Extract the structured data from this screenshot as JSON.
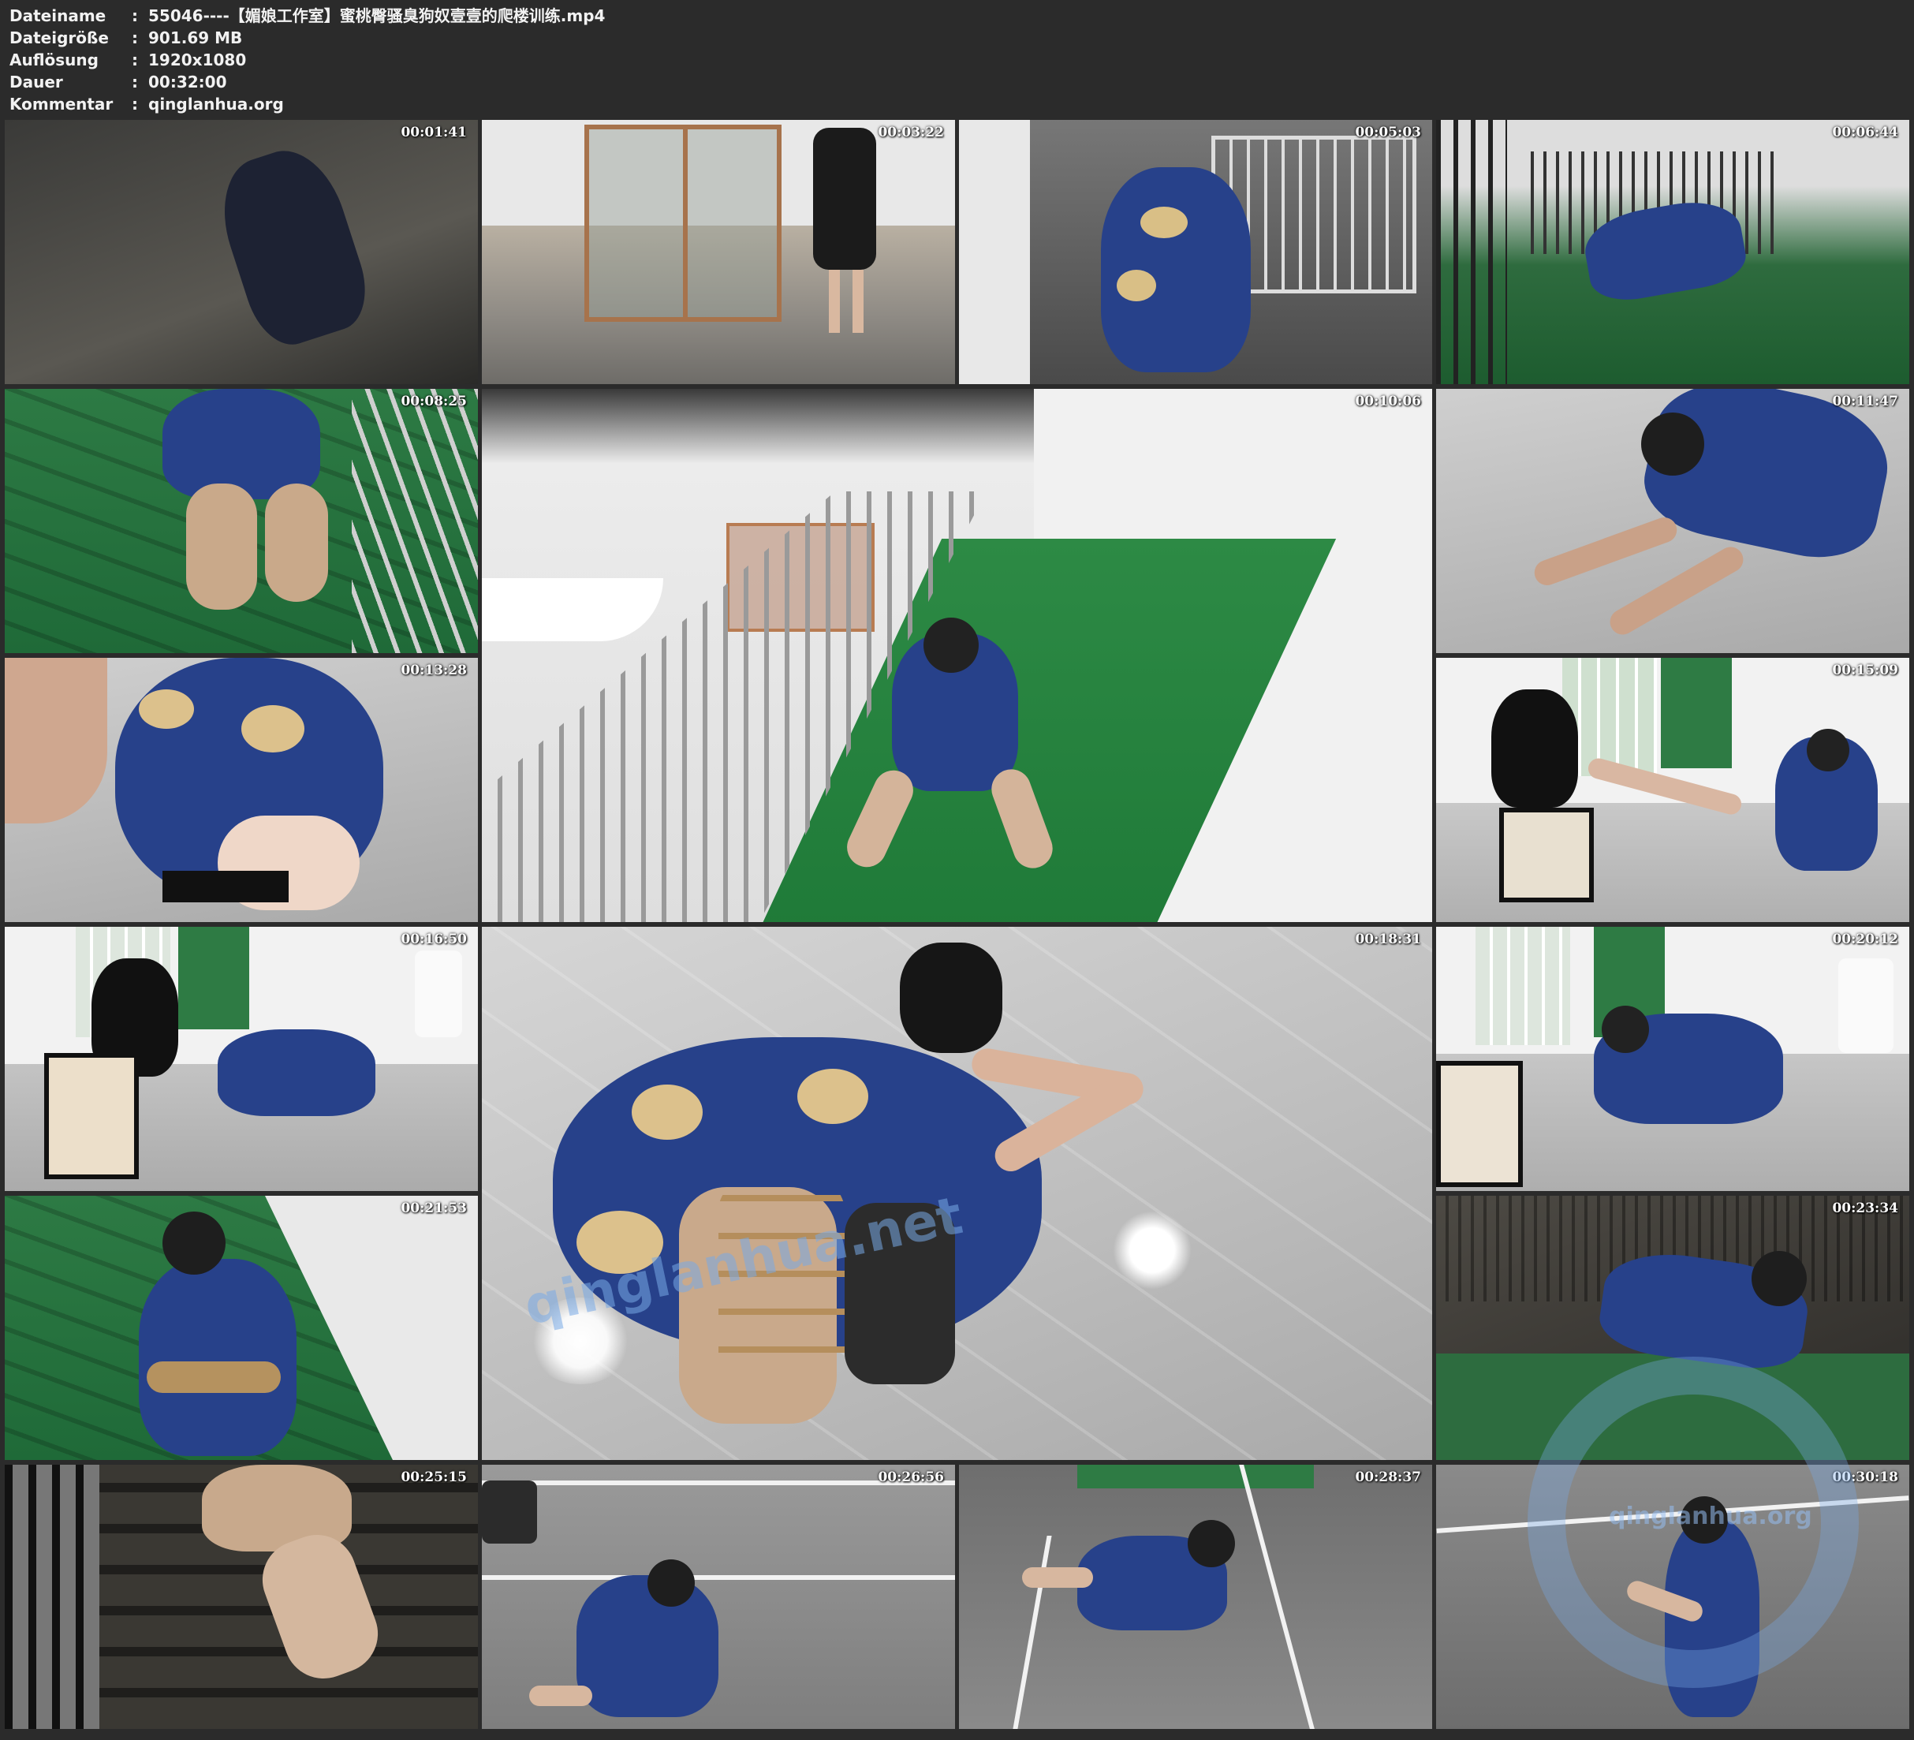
{
  "file_info": {
    "rows": [
      {
        "label": "Dateiname",
        "sep": ":",
        "value": "55046----【媚娘工作室】蜜桃臀骚臭狗奴壹壹的爬楼训练.mp4"
      },
      {
        "label": "Dateigröße",
        "sep": ":",
        "value": "901.69 MB"
      },
      {
        "label": "Auflösung",
        "sep": ":",
        "value": "1920x1080"
      },
      {
        "label": "Dauer",
        "sep": ":",
        "value": "00:32:00"
      },
      {
        "label": "Kommentar",
        "sep": ":",
        "value": "qinglanhua.org"
      }
    ]
  },
  "thumbnails": [
    {
      "timestamp": "00:01:41"
    },
    {
      "timestamp": "00:03:22"
    },
    {
      "timestamp": "00:05:03"
    },
    {
      "timestamp": "00:06:44"
    },
    {
      "timestamp": "00:08:25"
    },
    {
      "timestamp": "00:10:06"
    },
    {
      "timestamp": "00:11:47"
    },
    {
      "timestamp": "00:13:28"
    },
    {
      "timestamp": "00:15:09"
    },
    {
      "timestamp": "00:16:50"
    },
    {
      "timestamp": "00:18:31"
    },
    {
      "timestamp": "00:20:12"
    },
    {
      "timestamp": "00:21:53"
    },
    {
      "timestamp": "00:23:34"
    },
    {
      "timestamp": "00:25:15"
    },
    {
      "timestamp": "00:26:56"
    },
    {
      "timestamp": "00:28:37"
    },
    {
      "timestamp": "00:30:18"
    }
  ],
  "watermarks": {
    "corner": "qinglanhua.org",
    "center": "qinglanhua.net"
  },
  "colors": {
    "background": "#2b2b2b",
    "text": "#f2f2f2",
    "dress_blue": "#27418a",
    "floor_green": "#2d7a44"
  }
}
